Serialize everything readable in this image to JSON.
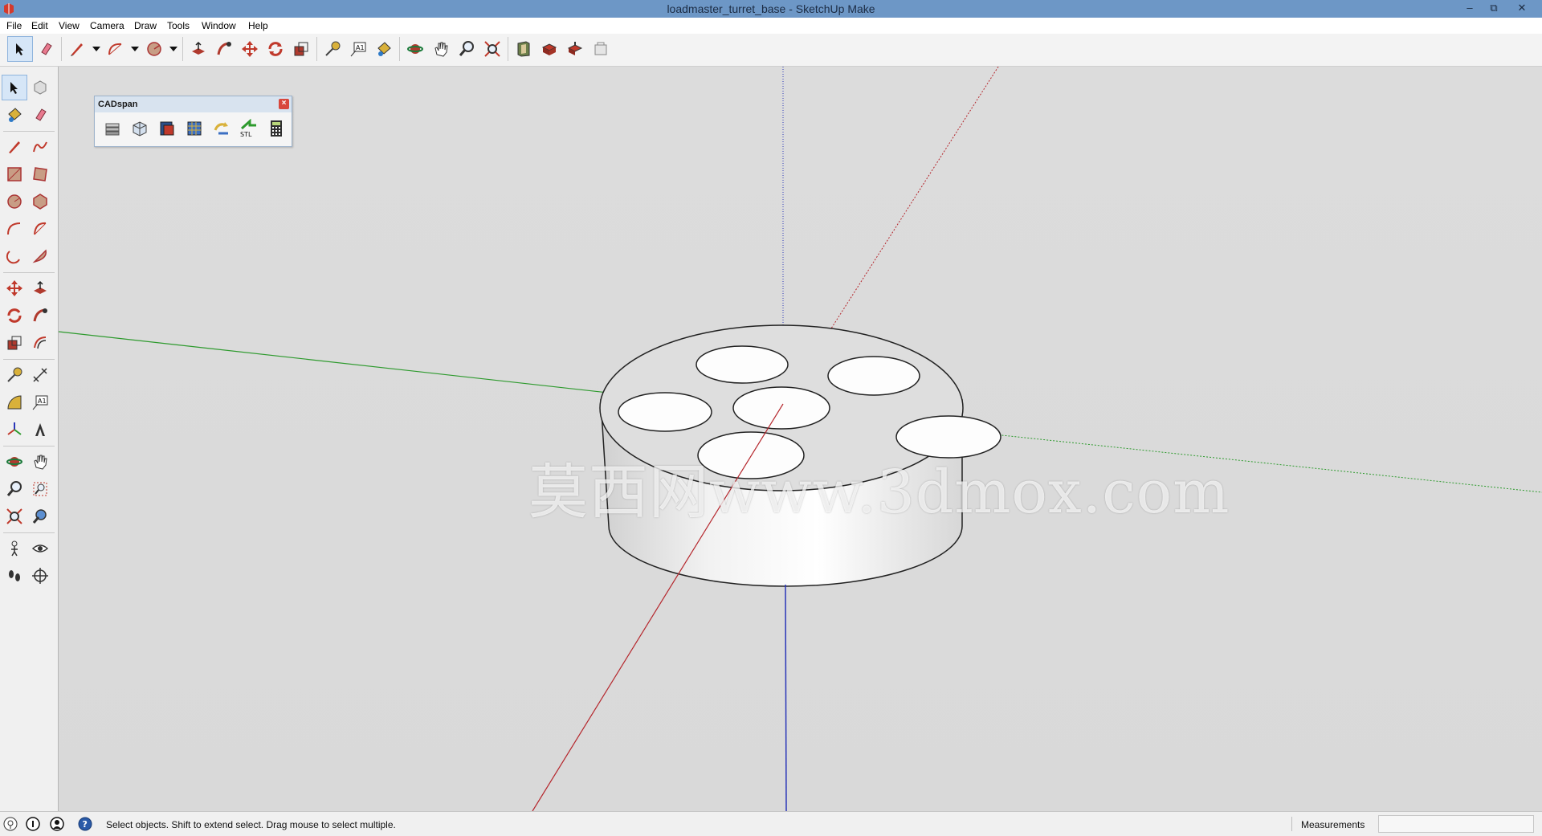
{
  "window": {
    "title": "loadmaster_turret_base - SketchUp Make",
    "minimize_label": "–",
    "restore_label": "⧉",
    "close_label": "✕"
  },
  "menu": {
    "items": [
      "File",
      "Edit",
      "View",
      "Camera",
      "Draw",
      "Tools",
      "Window",
      "Help"
    ]
  },
  "cadspan": {
    "title": "CADspan",
    "close_label": "×"
  },
  "status": {
    "message": "Select objects. Shift to extend select. Drag mouse to select multiple.",
    "measurements_label": "Measurements",
    "measurements_value": ""
  },
  "watermark": {
    "text": "莫西网www.3dmox.com"
  },
  "colors": {
    "red_axis": "#b5262c",
    "green_axis": "#2d9a2d",
    "blue_axis": "#2a36b8",
    "titlebar": "#6d97c6"
  }
}
